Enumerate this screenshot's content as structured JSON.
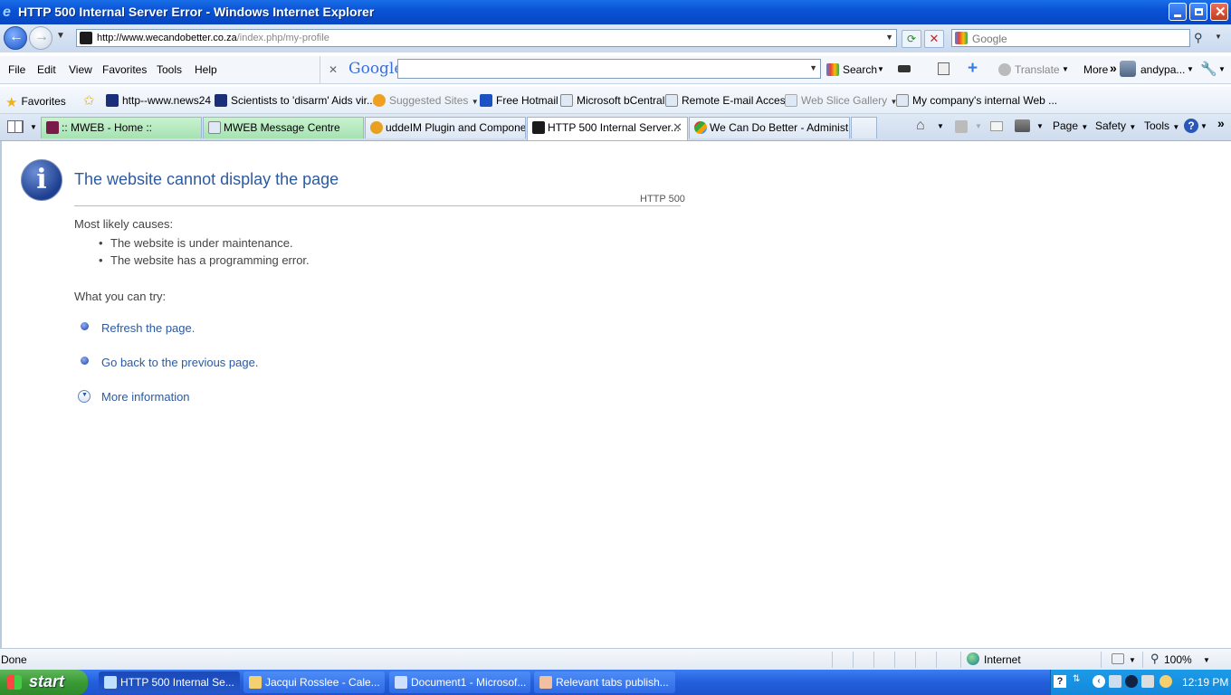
{
  "window": {
    "title": "HTTP 500 Internal Server Error - Windows Internet Explorer"
  },
  "address": {
    "url_domain": "http://www.wecandobetter.co.za",
    "url_path": "/index.php/my-profile",
    "search_placeholder": "Google"
  },
  "menu": {
    "items": [
      "File",
      "Edit",
      "View",
      "Favorites",
      "Tools",
      "Help"
    ]
  },
  "google_toolbar": {
    "close": "✕",
    "logo": "Google",
    "search_label": "Search",
    "translate_label": "Translate",
    "more_label": "More",
    "user_label": "andypa..."
  },
  "favorites": {
    "label": "Favorites",
    "items": [
      "http--www.news24",
      "Scientists to 'disarm' Aids vir...",
      "Suggested Sites",
      "Free Hotmail",
      "Microsoft bCentral",
      "Remote E-mail Access",
      "Web Slice Gallery",
      "My company's internal Web ..."
    ]
  },
  "tabs": [
    ":: MWEB - Home ::",
    "MWEB Message Centre",
    "uddeIM Plugin and Compone...",
    "HTTP 500 Internal Server...",
    "We Can Do Better - Administ..."
  ],
  "command_bar": {
    "page": "Page",
    "safety": "Safety",
    "tools": "Tools"
  },
  "error_page": {
    "heading": "The website cannot display the page",
    "code": "HTTP 500",
    "causes_title": "Most likely causes:",
    "causes": [
      "The website is under maintenance.",
      "The website has a programming error."
    ],
    "try_title": "What you can try:",
    "actions": [
      "Refresh the page.",
      "Go back to the previous page."
    ],
    "more_info": "More information"
  },
  "status": {
    "text": "Done",
    "zone": "Internet",
    "zoom": "100%"
  },
  "taskbar": {
    "start": "start",
    "tasks": [
      "HTTP 500 Internal Se...",
      "Jacqui Rosslee - Cale...",
      "Document1 - Microsof...",
      "Relevant tabs publish..."
    ],
    "clock": "12:19 PM"
  },
  "colors": {
    "link_blue": "#2c5aa0",
    "titlebar_blue": "#0a53d6",
    "taskbar_blue": "#245fdb",
    "start_green": "#3a9b35"
  }
}
